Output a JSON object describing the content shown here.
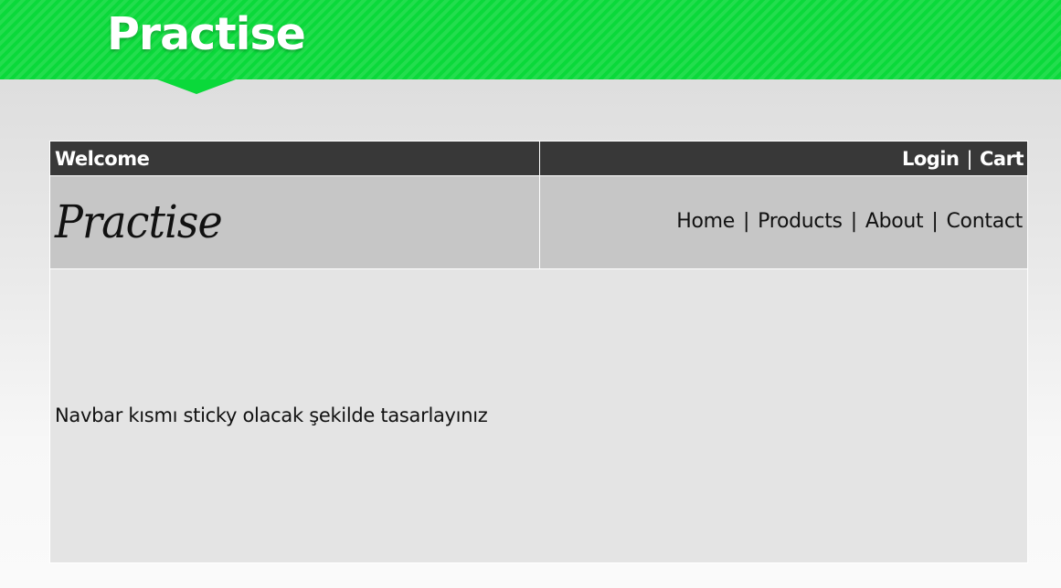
{
  "banner": {
    "title": "Practise",
    "color": "#0ad93a"
  },
  "header": {
    "welcome": "Welcome",
    "login": "Login",
    "separator": "|",
    "cart": "Cart",
    "background": "#383838"
  },
  "brand": {
    "logo_text": "Practise"
  },
  "nav": {
    "items": [
      "Home",
      "Products",
      "About",
      "Contact"
    ],
    "separator": "|"
  },
  "content": {
    "text": "Navbar kısmı sticky olacak şekilde tasarlayınız"
  }
}
